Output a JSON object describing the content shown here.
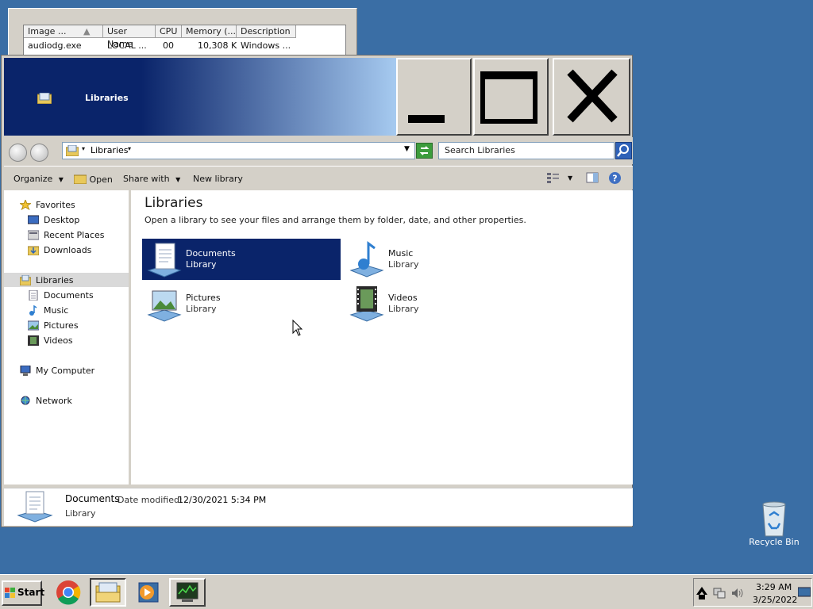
{
  "task_manager": {
    "columns": [
      "Image ...",
      "User Name",
      "CPU",
      "Memory (...",
      "Description"
    ],
    "row": [
      "audiodg.exe",
      "LOCAL ...",
      "00",
      "10,308 K",
      "Windows ..."
    ]
  },
  "window": {
    "title": "Libraries",
    "address": "Libraries",
    "search_placeholder": "Search Libraries"
  },
  "commands": {
    "organize": "Organize",
    "open": "Open",
    "share_with": "Share with",
    "new_library": "New library"
  },
  "nav": {
    "favorites": "Favorites",
    "desktop": "Desktop",
    "recent_places": "Recent Places",
    "downloads": "Downloads",
    "libraries": "Libraries",
    "documents": "Documents",
    "music": "Music",
    "pictures": "Pictures",
    "videos": "Videos",
    "my_computer": "My Computer",
    "network": "Network"
  },
  "content": {
    "heading": "Libraries",
    "subheading": "Open a library to see your files and arrange them by folder, date, and other properties.",
    "tiles": [
      {
        "name": "Documents",
        "type": "Library"
      },
      {
        "name": "Music",
        "type": "Library"
      },
      {
        "name": "Pictures",
        "type": "Library"
      },
      {
        "name": "Videos",
        "type": "Library"
      }
    ]
  },
  "details": {
    "name": "Documents",
    "date_label": "Date modified:",
    "date_value": "12/30/2021 5:34 PM",
    "type": "Library"
  },
  "desktop": {
    "recycle_bin": "Recycle Bin"
  },
  "taskbar": {
    "start": "Start",
    "time": "3:29 AM",
    "date": "3/25/2022"
  },
  "colors": {
    "selection": "#0a246a",
    "desktop": "#3a6ea5"
  }
}
